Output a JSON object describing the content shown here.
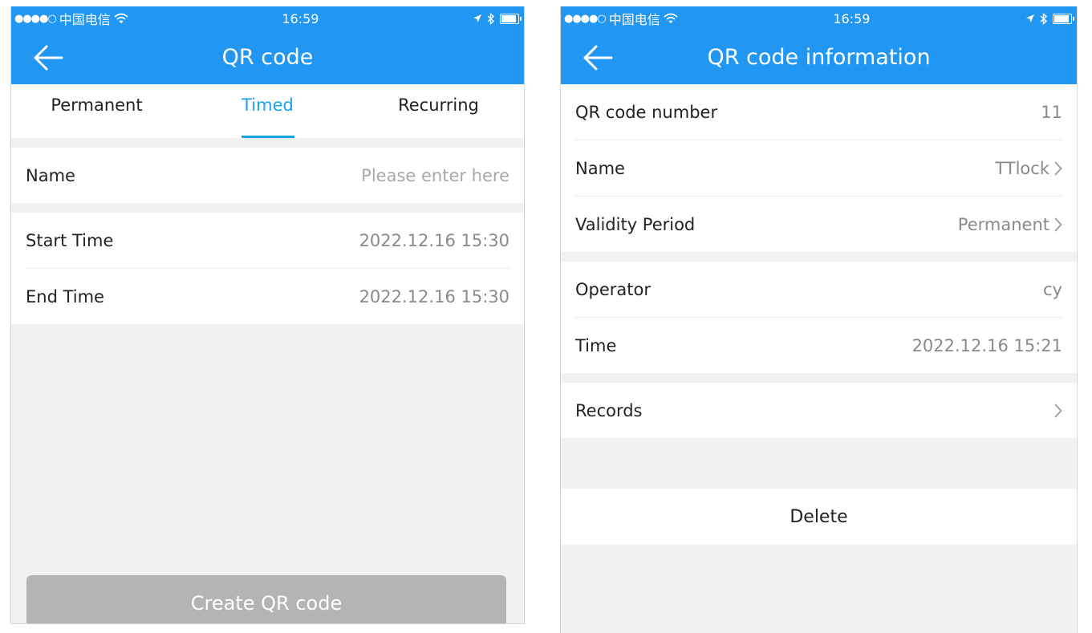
{
  "status_bar": {
    "carrier_dots": "●●●●○",
    "carrier": "中国电信",
    "time": "16:59"
  },
  "left_screen": {
    "title": "QR code",
    "tabs": [
      {
        "label": "Permanent",
        "active": false
      },
      {
        "label": "Timed",
        "active": true
      },
      {
        "label": "Recurring",
        "active": false
      }
    ],
    "name_label": "Name",
    "name_placeholder": "Please enter here",
    "start_time_label": "Start Time",
    "start_time_value": "2022.12.16 15:30",
    "end_time_label": "End Time",
    "end_time_value": "2022.12.16 15:30",
    "create_button": "Create QR code"
  },
  "right_screen": {
    "title": "QR code information",
    "rows": {
      "number": {
        "label": "QR code number",
        "value": "11"
      },
      "name": {
        "label": "Name",
        "value": "TTlock"
      },
      "validity": {
        "label": "Validity Period",
        "value": "Permanent"
      },
      "operator": {
        "label": "Operator",
        "value": "cy"
      },
      "time": {
        "label": "Time",
        "value": "2022.12.16 15:21"
      },
      "records": {
        "label": "Records"
      }
    },
    "delete_button": "Delete"
  },
  "colors": {
    "header_blue": "#2196f3",
    "active_tab": "#1aa3e8",
    "disabled_button": "#b4b4b4",
    "background_gray": "#f1f1f1"
  },
  "icons": [
    "back-arrow-icon",
    "wifi-icon",
    "location-arrow-icon",
    "bluetooth-icon",
    "battery-icon",
    "chevron-right-icon"
  ]
}
